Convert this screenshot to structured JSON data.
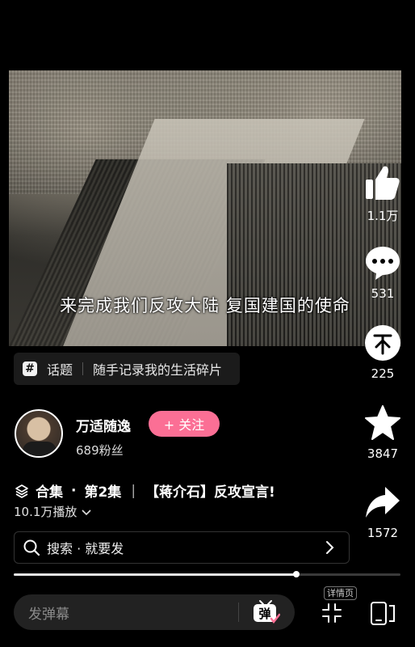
{
  "video": {
    "subtitle": "来完成我们反攻大陆 复国建国的使命"
  },
  "topic": {
    "prefix": "话题",
    "text": "随手记录我的生活碎片"
  },
  "author": {
    "name": "万适随逸",
    "fans": "689粉丝",
    "follow_label": "+ 关注"
  },
  "series": {
    "label": "合集",
    "dot": "·",
    "episode": "第2集",
    "bar": "|",
    "title": "【蒋介石】反攻宣言!"
  },
  "plays": "10.1万播放",
  "search": {
    "label": "搜索 · 就要发"
  },
  "progress": {
    "fraction": 0.73
  },
  "danmaku": {
    "placeholder": "发弹幕",
    "button_label": "弹"
  },
  "detail_tag": "详情页",
  "actions": {
    "like": "1.1万",
    "comment": "531",
    "coin": "225",
    "favorite": "3847",
    "share": "1572"
  },
  "colors": {
    "accent": "#fb6f95",
    "background": "#000000"
  }
}
